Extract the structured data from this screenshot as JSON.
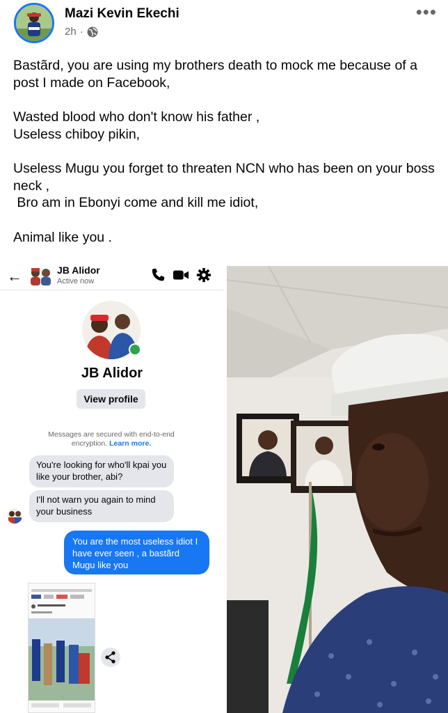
{
  "post": {
    "author": "Mazi Kevin Ekechi",
    "time": "2h",
    "separator": "·",
    "more": "•••",
    "paragraphs": [
      [
        "Bastãrd, you are using my brothers death to mock me because of a post I made on Facebook,"
      ],
      [
        "Wasted blood who don't know his father ,",
        "Useless chiboy pikin,"
      ],
      [
        "Useless Mugu you forget to threaten NCN who has been on your boss neck ,",
        " Bro am in Ebonyi come and kill me idiot,"
      ],
      [
        "Animal like you ."
      ]
    ]
  },
  "messenger": {
    "contact_name": "JB Alidor",
    "status": "Active now",
    "back_icon": "←",
    "view_profile_label": "View profile",
    "secure_text": "Messages are secured with end-to-end encryption.",
    "learn_more": "Learn more.",
    "messages_in": [
      "You're looking for who'll kpai you like your brother, abi?",
      "I'll not warn you again to mind your business"
    ],
    "message_out": "You are the most useless idiot I have ever seen , a bastãrd Mugu like you"
  },
  "colors": {
    "facebook_blue": "#1877f2",
    "online_green": "#31a24c",
    "bubble_grey": "#e4e6eb"
  },
  "icons": [
    "globe-icon",
    "more-icon",
    "back-arrow-icon",
    "phone-icon",
    "video-icon",
    "gear-icon",
    "share-icon"
  ]
}
